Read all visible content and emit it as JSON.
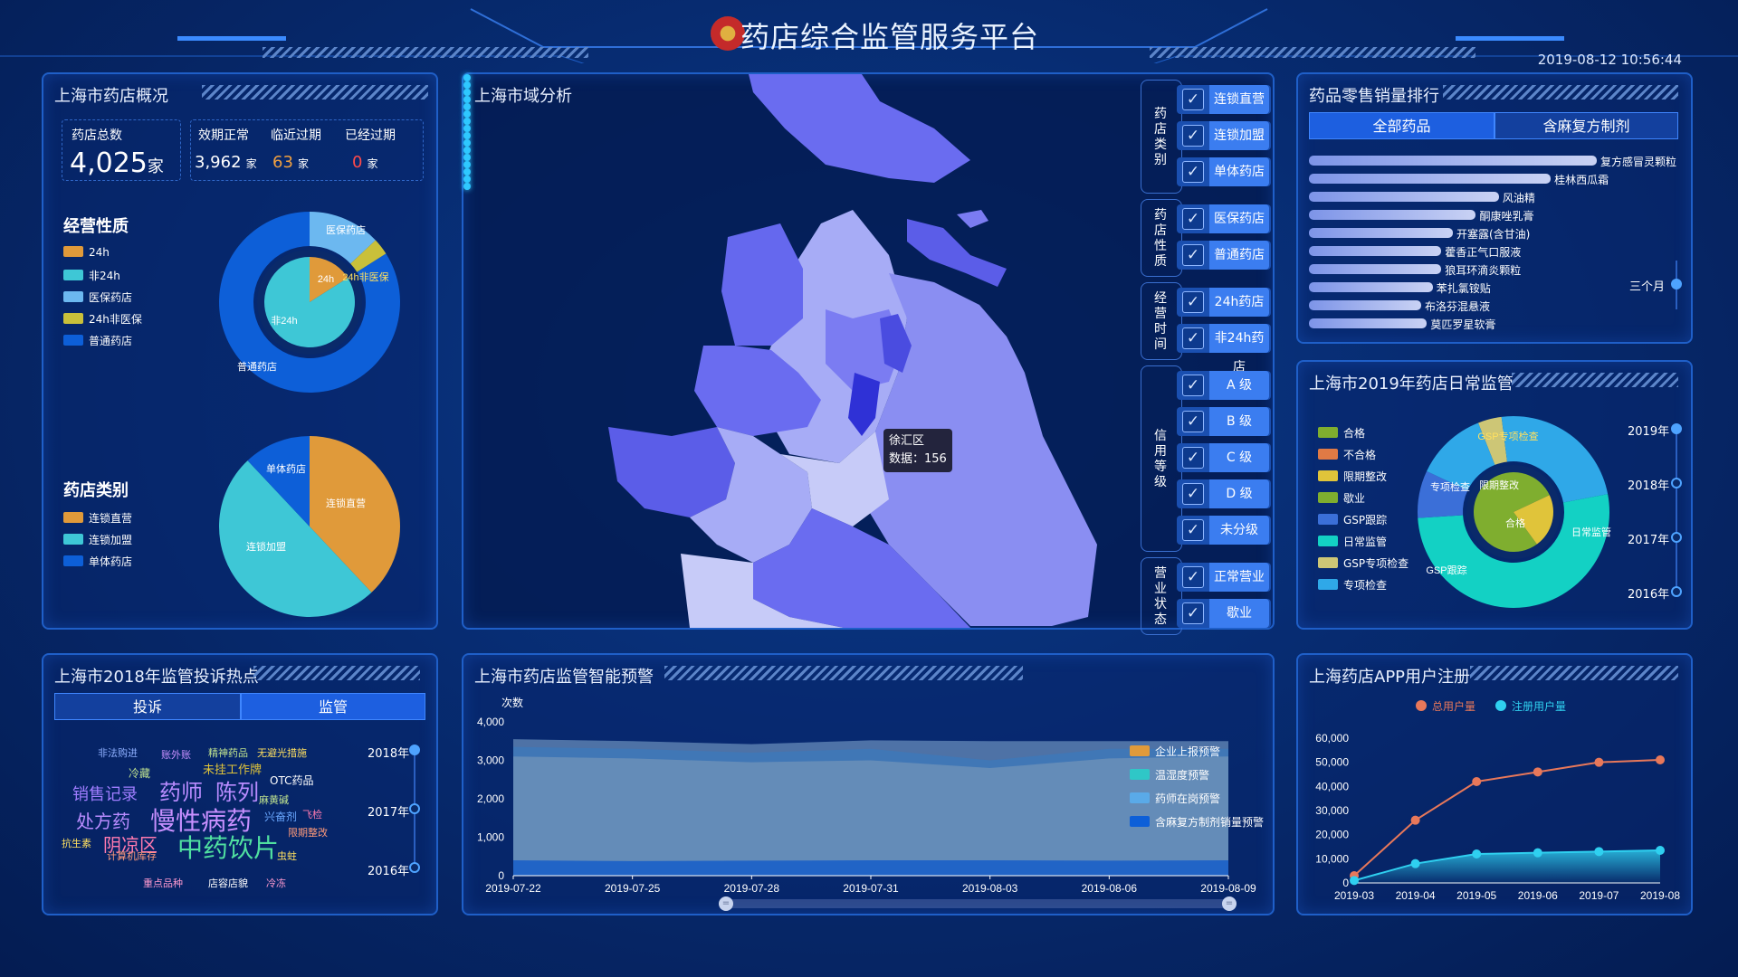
{
  "header": {
    "title": "药店综合监管服务平台",
    "datetime": "2019-08-12 10:56:44"
  },
  "overview": {
    "title": "上海市药店概况",
    "total_label": "药店总数",
    "total_value": "4,025",
    "total_unit": "家",
    "valid_label": "效期正常",
    "valid_value": "3,962",
    "valid_unit": "家",
    "near_label": "临近过期",
    "near_value": "63",
    "near_unit": "家",
    "expired_label": "已经过期",
    "expired_value": "0",
    "expired_unit": "家",
    "nature_title": "经营性质",
    "nature_legend": [
      "24h",
      "非24h",
      "医保药店",
      "24h非医保",
      "普通药店"
    ],
    "nature_colors": [
      "#e09a3a",
      "#3ec7d6",
      "#6cb8f0",
      "#c9c03a",
      "#0d5fd8"
    ],
    "nature_labels": [
      "医保药店",
      "24h",
      "24h非医保",
      "非24h",
      "普通药店"
    ],
    "category_title": "药店类别",
    "category_legend": [
      "连锁直营",
      "连锁加盟",
      "单体药店"
    ],
    "category_colors": [
      "#e09a3a",
      "#3ec7d6",
      "#0d5fd8"
    ],
    "category_labels": [
      "单体药店",
      "连锁直营",
      "连锁加盟"
    ]
  },
  "map": {
    "title": "上海市域分析",
    "tooltip_region": "徐汇区",
    "tooltip_text": "数据：156",
    "groups": [
      {
        "label": "药店类别",
        "items": [
          "连锁直营",
          "连锁加盟",
          "单体药店"
        ]
      },
      {
        "label": "药店性质",
        "items": [
          "医保药店",
          "普通药店"
        ]
      },
      {
        "label": "经营时间",
        "items": [
          "24h药店",
          "非24h药店"
        ]
      },
      {
        "label": "信用等级",
        "items": [
          "A 级",
          "B 级",
          "C 级",
          "D 级",
          "未分级"
        ]
      },
      {
        "label": "营业状态",
        "items": [
          "正常营业",
          "歇业"
        ]
      }
    ],
    "check_mark": "✓"
  },
  "ranking": {
    "title": "药品零售销量排行",
    "tabs": [
      "全部药品",
      "含麻复方制剂"
    ],
    "items": [
      {
        "name": "复方感冒灵颗粒",
        "value": 100
      },
      {
        "name": "桂林西瓜霜",
        "value": 84
      },
      {
        "name": "风油精",
        "value": 66
      },
      {
        "name": "酮康唑乳膏",
        "value": 58
      },
      {
        "name": "开塞露(含甘油)",
        "value": 50
      },
      {
        "name": "藿香正气口服液",
        "value": 46
      },
      {
        "name": "狼耳环滴炎颗粒",
        "value": 46
      },
      {
        "name": "苯扎氯铵贴",
        "value": 43
      },
      {
        "name": "布洛芬混悬液",
        "value": 39
      },
      {
        "name": "莫匹罗星软膏",
        "value": 41
      }
    ],
    "period_label": "三个月"
  },
  "daily": {
    "title": "上海市2019年药店日常监管",
    "legend": [
      "合格",
      "不合格",
      "限期整改",
      "歇业",
      "GSP跟踪",
      "日常监管",
      "GSP专项检查",
      "专项检查"
    ],
    "legend_colors": [
      "#7fae2f",
      "#e07a45",
      "#e0c43a",
      "#7fae2f",
      "#3b6fd8",
      "#13d1c4",
      "#cdc676",
      "#2fa8e8"
    ],
    "ring_labels": [
      "GSP专项检查",
      "专项检查",
      "日常监管",
      "GSP跟踪",
      "限期整改",
      "合格"
    ],
    "years": [
      "2019年",
      "2018年",
      "2017年",
      "2016年"
    ]
  },
  "hotspots": {
    "title": "上海市2018年监管投诉热点",
    "tabs": [
      "投诉",
      "监管"
    ],
    "words": [
      "非法购进",
      "账外账",
      "精神药品",
      "无避光措施",
      "冷藏",
      "未挂工作牌",
      "销售记录",
      "药师",
      "陈列",
      "OTC药品",
      "麻黄碱",
      "处方药",
      "慢性病药",
      "兴奋剂",
      "飞检",
      "限期整改",
      "抗生素",
      "阴凉区",
      "中药饮片",
      "计算机库存",
      "虫蛀",
      "重点品种",
      "店容店貌",
      "冷冻"
    ],
    "years": [
      "2018年",
      "2017年",
      "2016年"
    ]
  },
  "warning": {
    "title": "上海市药店监管智能预警",
    "y_unit": "次数",
    "legend": [
      "企业上报预警",
      "温湿度预警",
      "药师在岗预警",
      "含麻复方制剂销量预警"
    ],
    "legend_colors": [
      "#e09a3a",
      "#2fc7c7",
      "#5aaae8",
      "#0d5fd8"
    ]
  },
  "app": {
    "title": "上海药店APP用户注册",
    "legend": [
      "总用户量",
      "注册用户量"
    ],
    "legend_colors": [
      "#e8785a",
      "#2fd0f0"
    ]
  },
  "chart_data": [
    {
      "type": "area",
      "title": "上海市药店监管智能预警",
      "ylabel": "次数",
      "ylim": [
        0,
        4000
      ],
      "yticks": [
        "0",
        "1,000",
        "2,000",
        "3,000",
        "4,000"
      ],
      "x": [
        "2019-07-22",
        "2019-07-25",
        "2019-07-28",
        "2019-07-31",
        "2019-08-03",
        "2019-08-06",
        "2019-08-09"
      ],
      "series": [
        {
          "name": "企业上报预警",
          "values": [
            3550,
            3500,
            3420,
            3520,
            3500,
            3500,
            3500
          ]
        },
        {
          "name": "温湿度预警",
          "values": [
            3350,
            3300,
            3200,
            3300,
            3000,
            3300,
            3300
          ]
        },
        {
          "name": "药师在岗预警",
          "values": [
            3100,
            3050,
            2950,
            3000,
            2800,
            3050,
            3100
          ]
        },
        {
          "name": "含麻复方制剂销量预警",
          "values": [
            400,
            380,
            390,
            400,
            400,
            390,
            400
          ]
        }
      ]
    },
    {
      "type": "line",
      "title": "上海药店APP用户注册",
      "ylim": [
        0,
        60000
      ],
      "yticks": [
        "0",
        "10,000",
        "20,000",
        "30,000",
        "40,000",
        "50,000",
        "60,000"
      ],
      "x": [
        "2019-03",
        "2019-04",
        "2019-05",
        "2019-06",
        "2019-07",
        "2019-08"
      ],
      "series": [
        {
          "name": "总用户量",
          "values": [
            3000,
            26000,
            42000,
            46000,
            50000,
            51000
          ]
        },
        {
          "name": "注册用户量",
          "values": [
            1000,
            8000,
            12000,
            12500,
            13000,
            13500
          ]
        }
      ]
    },
    {
      "type": "pie",
      "title": "经营性质",
      "categories": [
        "24h",
        "非24h",
        "医保药店",
        "24h非医保",
        "普通药店"
      ],
      "values": [
        16,
        84,
        13,
        3,
        84
      ]
    },
    {
      "type": "pie",
      "title": "药店类别",
      "categories": [
        "连锁直营",
        "连锁加盟",
        "单体药店"
      ],
      "values": [
        38,
        50,
        12
      ]
    }
  ]
}
